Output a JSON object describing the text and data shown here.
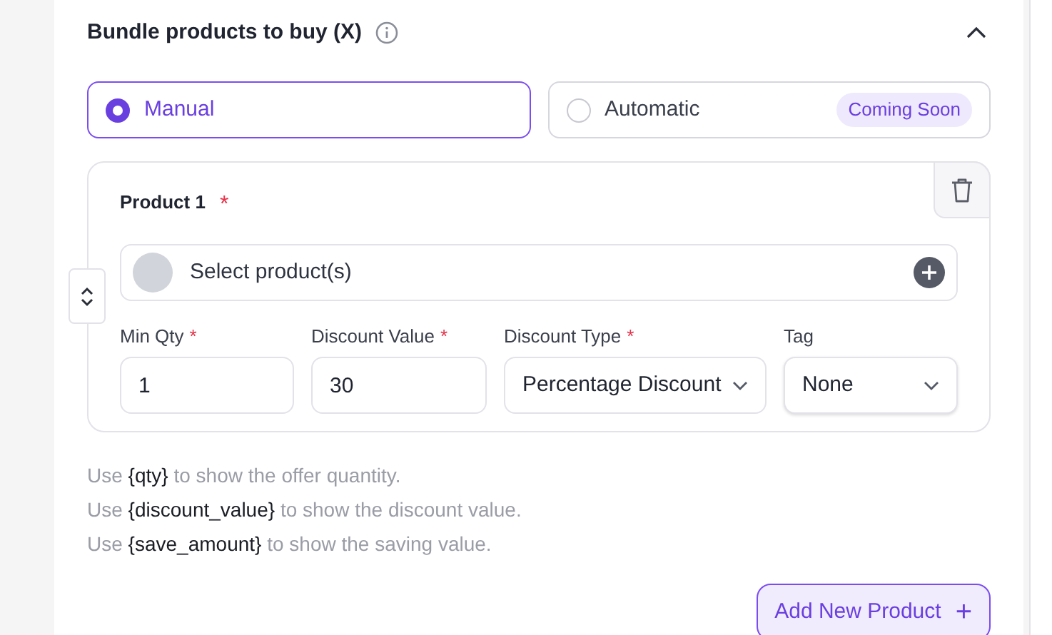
{
  "section": {
    "title": "Bundle products to buy (X)",
    "expanded": true
  },
  "modes": [
    {
      "label": "Manual",
      "selected": true
    },
    {
      "label": "Automatic",
      "selected": false,
      "badge": "Coming Soon"
    }
  ],
  "product": {
    "title": "Product 1",
    "mark": "*",
    "select": {
      "placeholder": "Select product(s)"
    },
    "fields": [
      {
        "kind": "input",
        "label": "Min Qty",
        "mark": "*",
        "value": "1"
      },
      {
        "kind": "input",
        "label": "Discount Value",
        "mark": "*",
        "value": "30"
      },
      {
        "kind": "select",
        "label": "Discount Type",
        "mark": "*",
        "value": "Percentage Discount"
      },
      {
        "kind": "select",
        "label": "Tag",
        "value": "None"
      }
    ]
  },
  "hints": [
    "Use **{qty}** to show the offer quantity.",
    "Use **{discount_value}** to show the discount value.",
    "Use **{save_amount}** to show the saving value."
  ],
  "add_button": {
    "label": "Add New Product",
    "icon": "+"
  }
}
